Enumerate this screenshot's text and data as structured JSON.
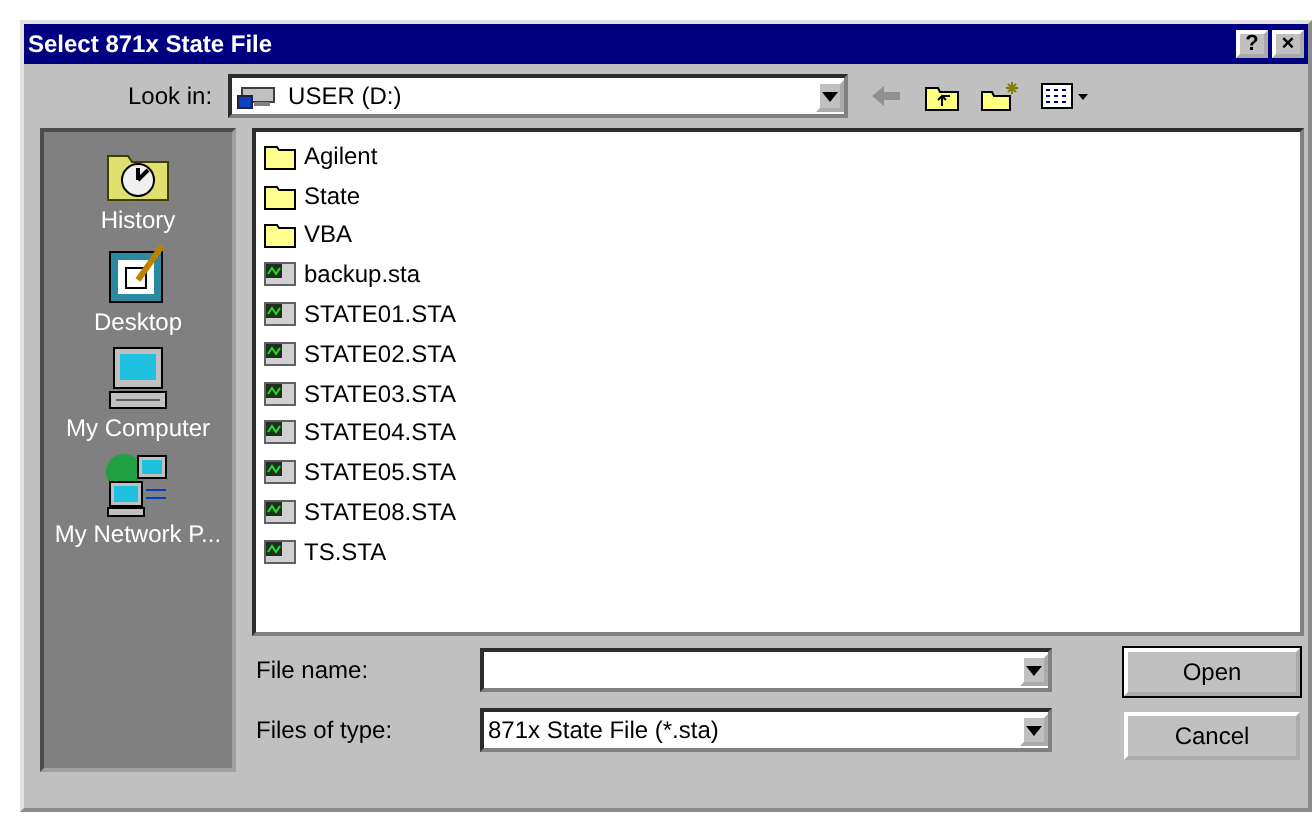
{
  "window": {
    "title": "Select 871x State File",
    "help_button": "?",
    "close_button": "×"
  },
  "look_in": {
    "label": "Look in:",
    "value": "USER (D:)"
  },
  "places": [
    {
      "label": "History",
      "kind": "history"
    },
    {
      "label": "Desktop",
      "kind": "desktop"
    },
    {
      "label": "My Computer",
      "kind": "computer"
    },
    {
      "label": "My Network P...",
      "kind": "network"
    }
  ],
  "files": [
    {
      "name": "Agilent",
      "kind": "folder"
    },
    {
      "name": "State",
      "kind": "folder"
    },
    {
      "name": "VBA",
      "kind": "folder"
    },
    {
      "name": "backup.sta",
      "kind": "file"
    },
    {
      "name": "STATE01.STA",
      "kind": "file"
    },
    {
      "name": "STATE02.STA",
      "kind": "file"
    },
    {
      "name": "STATE03.STA",
      "kind": "file"
    },
    {
      "name": "STATE04.STA",
      "kind": "file"
    },
    {
      "name": "STATE05.STA",
      "kind": "file"
    },
    {
      "name": "STATE08.STA",
      "kind": "file"
    },
    {
      "name": "TS.STA",
      "kind": "file"
    }
  ],
  "file_name": {
    "label": "File name:"
  },
  "file_type": {
    "label": "Files of type:",
    "value": "871x State File (*.sta)"
  },
  "buttons": [
    "Open",
    "Cancel"
  ]
}
